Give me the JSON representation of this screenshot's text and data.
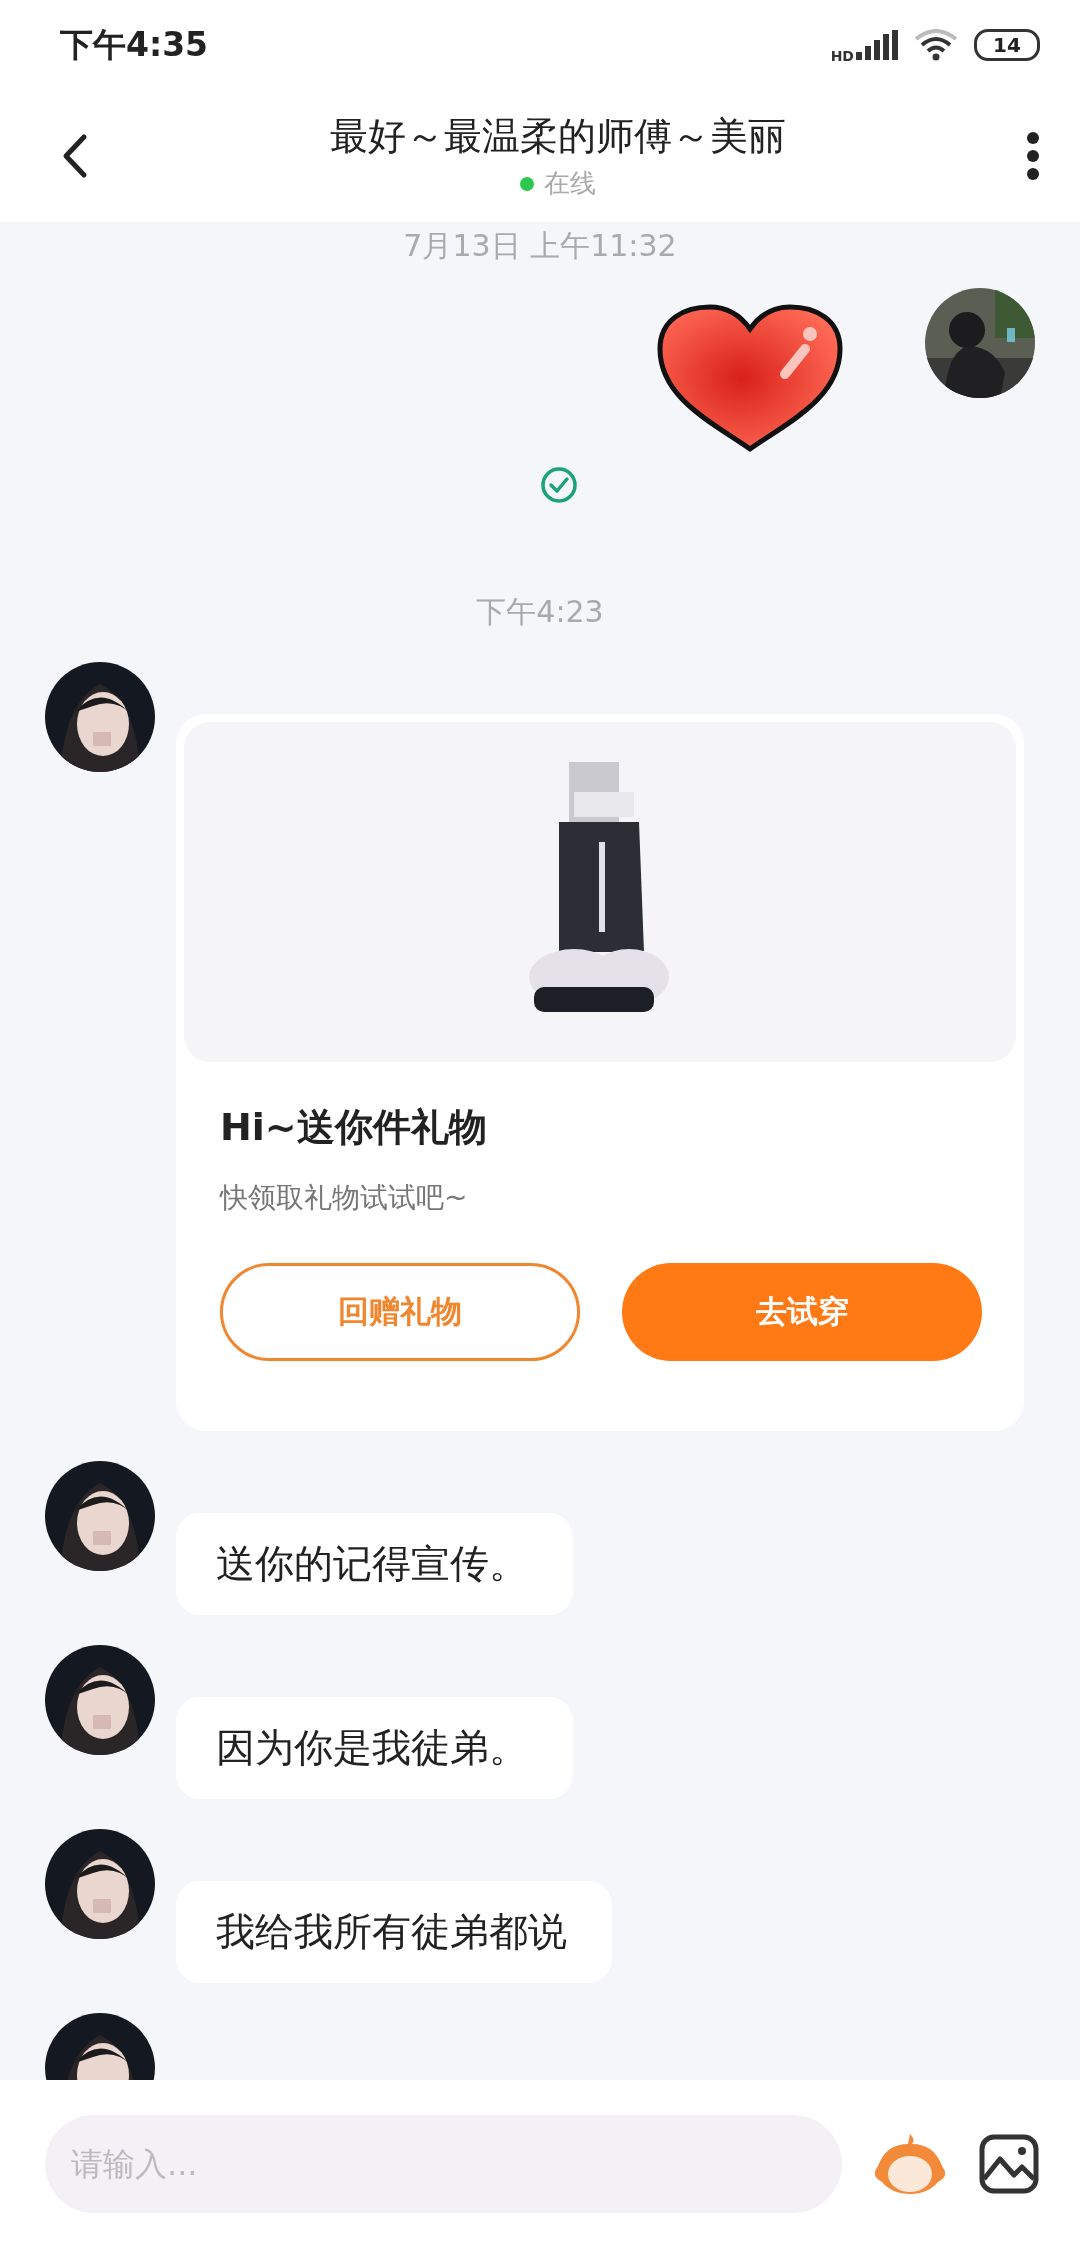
{
  "status_bar": {
    "time": "下午4:35",
    "network_label": "HD",
    "battery": "14"
  },
  "header": {
    "title": "最好～最温柔的师傅～美丽",
    "presence": "在线",
    "online": true
  },
  "messages": [
    {
      "kind": "timestamp",
      "text": "7月13日 上午11:32"
    },
    {
      "kind": "sticker",
      "outgoing": true,
      "read": true
    },
    {
      "kind": "timestamp",
      "text": "下午4:23"
    },
    {
      "kind": "gift_card",
      "outgoing": false,
      "title": "Hi~送你件礼物",
      "subtitle": "快领取礼物试试吧~",
      "buttons": [
        {
          "label": "回赠礼物",
          "kind": "outline"
        },
        {
          "label": "去试穿",
          "kind": "filled"
        }
      ]
    },
    {
      "kind": "text",
      "outgoing": false,
      "text": "送你的记得宣传。"
    },
    {
      "kind": "text",
      "outgoing": false,
      "text": "因为你是我徒弟。"
    },
    {
      "kind": "text",
      "outgoing": false,
      "text": "我给我所有徒弟都说"
    },
    {
      "kind": "partial",
      "outgoing": false
    }
  ],
  "composer": {
    "placeholder": "请输入..."
  }
}
